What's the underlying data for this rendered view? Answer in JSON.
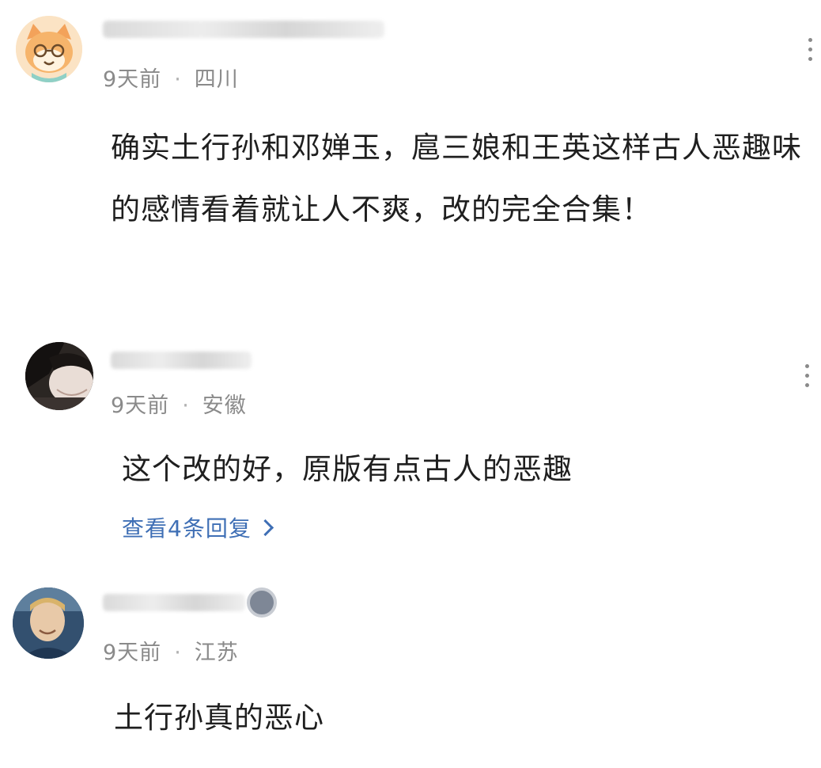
{
  "comments": [
    {
      "time": "9天前",
      "location": "四川",
      "separator": "·",
      "text": "确实土行孙和邓婵玉，扈三娘和王英这样古人恶趣味的感情看着就让人不爽，改的完全合集！",
      "avatar_icon": "cartoon-fox-avatar"
    },
    {
      "time": "9天前",
      "location": "安徽",
      "separator": "·",
      "text": "这个改的好，原版有点古人的恶趣",
      "replies_label": "查看4条回复",
      "avatar_icon": "anime-character-avatar"
    },
    {
      "time": "9天前",
      "location": "江苏",
      "separator": "·",
      "text": "土行孙真的恶心",
      "avatar_icon": "person-photo-avatar"
    }
  ],
  "colors": {
    "meta_gray": "#8a8a8a",
    "link_blue": "#3f6fb5",
    "text": "#1f1f1f"
  }
}
